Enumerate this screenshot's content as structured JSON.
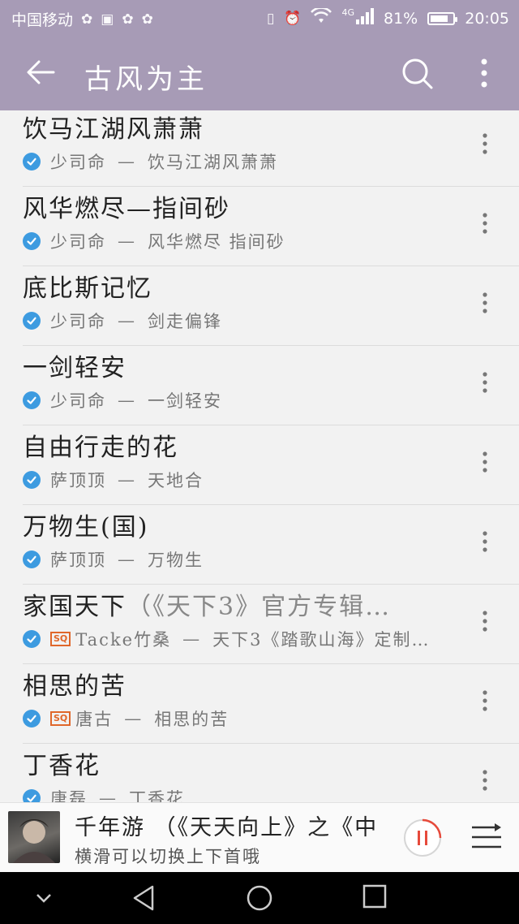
{
  "status_bar": {
    "carrier": "中国移动",
    "network": "4G",
    "battery": "81%",
    "battery_level": 0.81,
    "time": "20:05"
  },
  "app_bar": {
    "title": "古风为主"
  },
  "songs": [
    {
      "title": "饮马江湖风萧萧",
      "title_suffix": "",
      "sq": false,
      "artist": "少司命",
      "sep": "—",
      "album": "饮马江湖风萧萧"
    },
    {
      "title": "风华燃尽—指间砂",
      "title_suffix": "",
      "sq": false,
      "artist": "少司命",
      "sep": "—",
      "album": "风华燃尽 指间砂"
    },
    {
      "title": "底比斯记忆",
      "title_suffix": "",
      "sq": false,
      "artist": "少司命",
      "sep": "—",
      "album": "剑走偏锋"
    },
    {
      "title": "一剑轻安",
      "title_suffix": "",
      "sq": false,
      "artist": "少司命",
      "sep": "—",
      "album": "一剑轻安"
    },
    {
      "title": "自由行走的花",
      "title_suffix": "",
      "sq": false,
      "artist": "萨顶顶",
      "sep": "—",
      "album": "天地合"
    },
    {
      "title": "万物生(国)",
      "title_suffix": "",
      "sq": false,
      "artist": "萨顶顶",
      "sep": "—",
      "album": "万物生"
    },
    {
      "title": "家国天下",
      "title_suffix": "（《天下3》官方专辑…",
      "sq": true,
      "artist": "Tacke竹桑",
      "sep": "—",
      "album": "天下3《踏歌山海》定制…"
    },
    {
      "title": "相思的苦",
      "title_suffix": "",
      "sq": true,
      "artist": "唐古",
      "sep": "—",
      "album": "相思的苦"
    },
    {
      "title": "丁香花",
      "title_suffix": "",
      "sq": false,
      "artist": "唐磊",
      "sep": "—",
      "album": "丁香花"
    }
  ],
  "sq_label": "SQ",
  "player": {
    "song": "千年游 （《天天向上》之《中",
    "hint": "横滑可以切换上下首哦"
  },
  "colors": {
    "accent_bar": "#a79bb6",
    "check": "#3d9be0",
    "sq": "#e0672a",
    "pause_ring": "#e64a3b"
  }
}
